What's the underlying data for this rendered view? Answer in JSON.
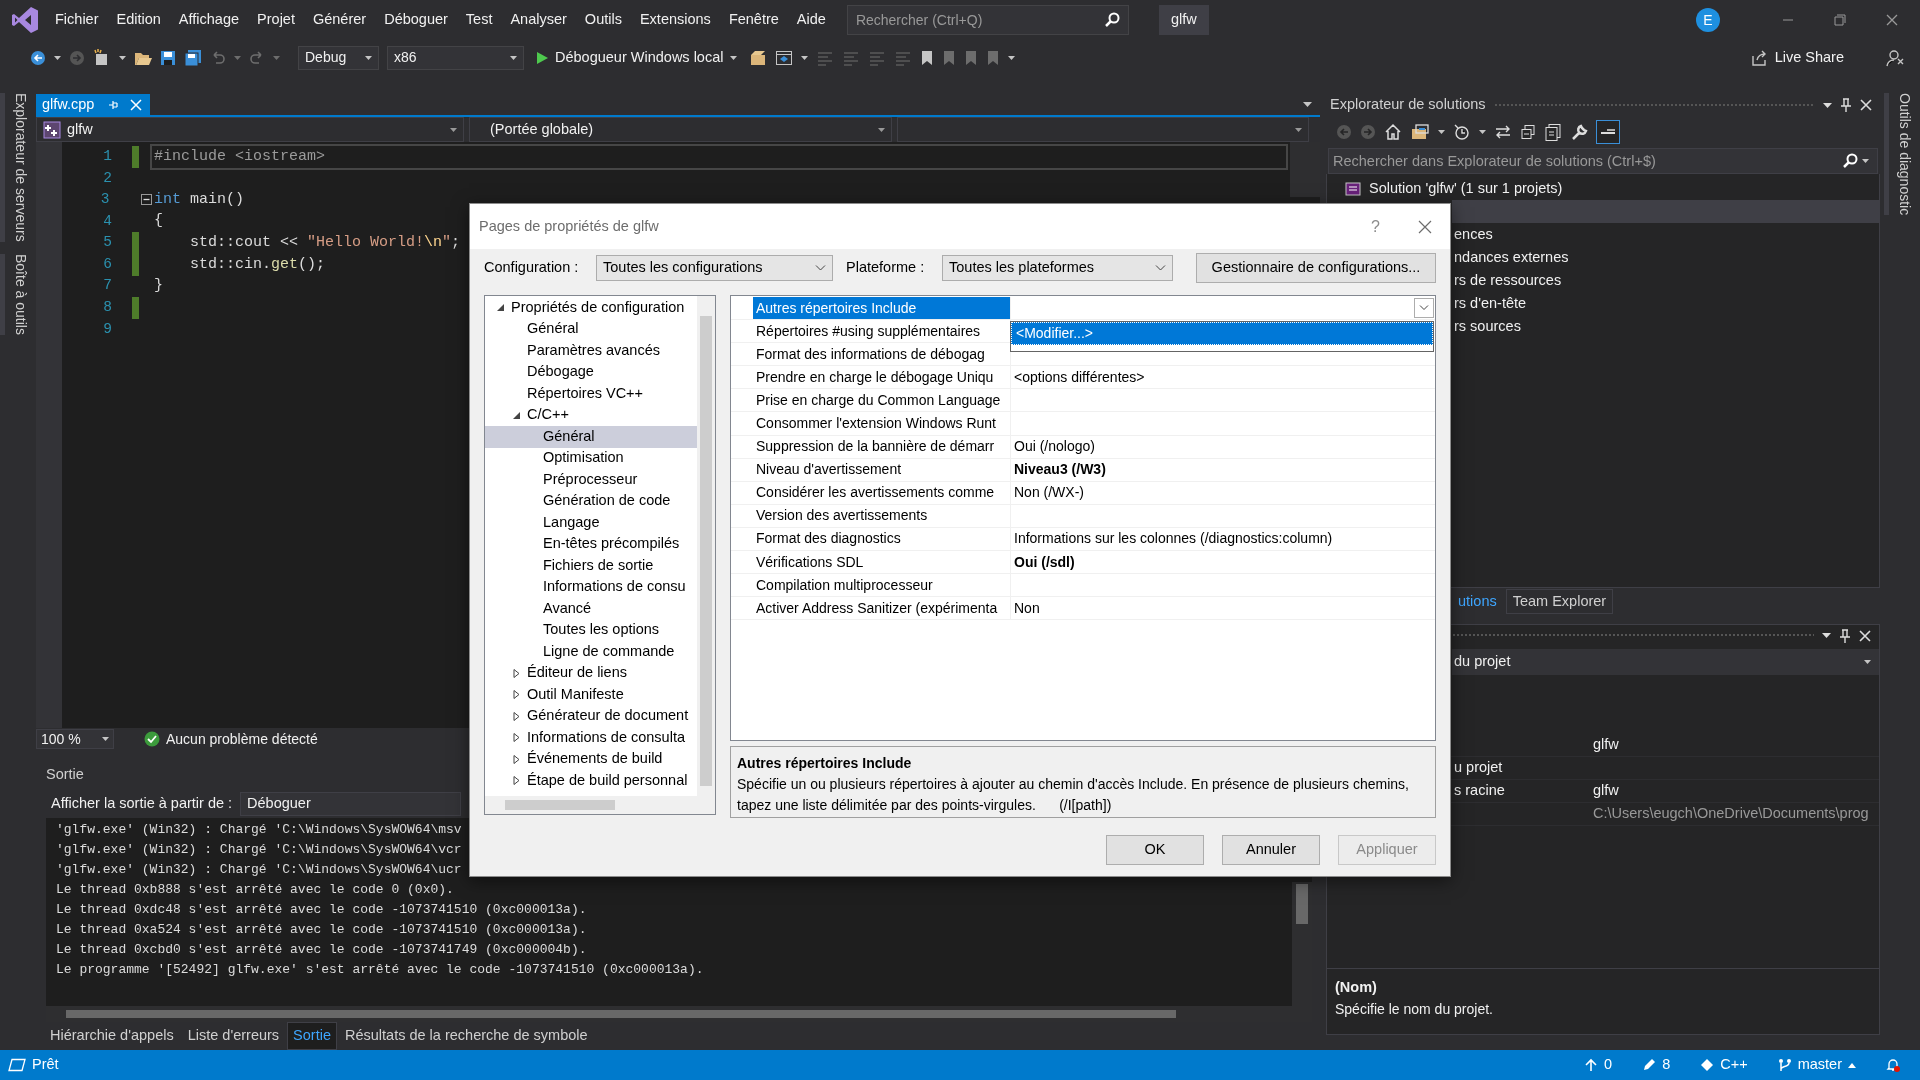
{
  "menu_bar": {
    "items": [
      "Fichier",
      "Edition",
      "Affichage",
      "Projet",
      "Générer",
      "Déboguer",
      "Test",
      "Analyser",
      "Outils",
      "Extensions",
      "Fenêtre",
      "Aide"
    ],
    "search": {
      "placeholder": "Rechercher (Ctrl+Q)"
    },
    "solution_name": "glfw",
    "avatar": "E"
  },
  "toolbar": {
    "configuration": "Debug",
    "platform": "x86",
    "run_button": "Débogueur Windows local",
    "live_share": "Live Share"
  },
  "side_tabs_left": [
    "Explorateur de serveurs",
    "Boîte à outils"
  ],
  "side_tabs_right": [
    "Outils de diagnostic"
  ],
  "editor": {
    "tabs": [
      {
        "label": "glfw.cpp",
        "selected": true
      }
    ],
    "project_combo": "glfw",
    "scope_combo": "(Portée globale)",
    "lines": [
      {
        "number": "1",
        "changed": true,
        "current": true,
        "fold_start": false,
        "code": [
          {
            "kind": "preproc",
            "text": "#include <iostream>"
          }
        ]
      },
      {
        "number": "2",
        "changed": false,
        "current": false,
        "fold_start": false
      },
      {
        "number": "3",
        "changed": false,
        "current": false,
        "fold_start": true,
        "code": [
          {
            "kind": "keyword",
            "text": "int"
          },
          {
            "kind": "plain",
            "text": " main()"
          }
        ]
      },
      {
        "number": "4",
        "changed": false,
        "current": false,
        "fold_start": false,
        "code": [
          {
            "kind": "plain",
            "text": "{"
          }
        ]
      },
      {
        "number": "5",
        "changed": true,
        "current": false,
        "fold_start": false,
        "code": [
          {
            "kind": "plain",
            "text": "    std::cout << "
          },
          {
            "kind": "string",
            "text": "\"Hello World!"
          },
          {
            "kind": "escape",
            "text": "\\n"
          },
          {
            "kind": "string",
            "text": "\""
          },
          {
            "kind": "plain",
            "text": ";"
          }
        ]
      },
      {
        "number": "6",
        "changed": true,
        "current": false,
        "fold_start": false,
        "code": [
          {
            "kind": "plain",
            "text": "    std::cin."
          },
          {
            "kind": "function",
            "text": "get"
          },
          {
            "kind": "plain",
            "text": "();"
          }
        ]
      },
      {
        "number": "7",
        "changed": false,
        "current": false,
        "fold_start": false,
        "code": [
          {
            "kind": "plain",
            "text": "}"
          }
        ]
      },
      {
        "number": "8",
        "changed": true,
        "current": false,
        "fold_start": false
      },
      {
        "number": "9",
        "changed": false,
        "current": false,
        "fold_start": false
      }
    ],
    "zoom": "100 %",
    "status": "Aucun problème détecté"
  },
  "output": {
    "title": "Sortie",
    "source_label": "Afficher la sortie à partir de :",
    "source": "Déboguer",
    "lines": [
      "'glfw.exe' (Win32) : Chargé 'C:\\Windows\\SysWOW64\\msv",
      "'glfw.exe' (Win32) : Chargé 'C:\\Windows\\SysWOW64\\vcr",
      "'glfw.exe' (Win32) : Chargé 'C:\\Windows\\SysWOW64\\ucr",
      "Le thread 0xb888 s'est arrêté avec le code 0 (0x0).",
      "Le thread 0xdc48 s'est arrêté avec le code -1073741510 (0xc000013a).",
      "Le thread 0xa524 s'est arrêté avec le code -1073741510 (0xc000013a).",
      "Le thread 0xcbd0 s'est arrêté avec le code -1073741749 (0xc000004b).",
      "Le programme '[52492] glfw.exe' s'est arrêté avec le code -1073741510 (0xc000013a)."
    ]
  },
  "bottom_tabs": [
    {
      "label": "Hiérarchie d'appels",
      "selected": false
    },
    {
      "label": "Liste d'erreurs",
      "selected": false
    },
    {
      "label": "Sortie",
      "selected": true
    },
    {
      "label": "Résultats de la recherche de symbole",
      "selected": false
    }
  ],
  "solution_explorer": {
    "title": "Explorateur de solutions",
    "search": {
      "placeholder": "Rechercher dans Explorateur de solutions (Ctrl+$)"
    },
    "items": [
      {
        "label": "Solution 'glfw' (1 sur 1 projets)",
        "selected": false
      },
      {
        "selected": true
      },
      {
        "label": "ences",
        "selected": false
      },
      {
        "label": "ndances externes",
        "selected": false
      },
      {
        "label": "rs de ressources",
        "selected": false
      },
      {
        "label": "rs d'en-tête",
        "selected": false
      },
      {
        "label": "rs sources",
        "selected": false
      }
    ],
    "tabs": [
      {
        "label": "utions",
        "selected": true
      },
      {
        "label": "Team Explorer",
        "selected": false
      }
    ]
  },
  "properties_panel": {
    "combo": "du projet",
    "rows": [
      {
        "value": {
          "text": "glfw",
          "disabled": false
        }
      },
      {
        "name": "u projet"
      },
      {
        "name": "s racine",
        "value": {
          "text": "glfw",
          "disabled": false
        }
      },
      {
        "value": {
          "text": "C:\\Users\\eugch\\OneDrive\\Documents\\prog",
          "disabled": true
        }
      }
    ],
    "description": {
      "title": "(Nom)",
      "text": "Spécifie le nom du projet."
    }
  },
  "status_bar": {
    "text": "Prêt",
    "push_count": "0",
    "pending_changes": "8",
    "language": "C++",
    "branch": "master"
  },
  "dialog": {
    "title": "Pages de propriétés de glfw",
    "help": "?",
    "configuration_label": "Configuration :",
    "configuration": "Toutes les configurations",
    "platform_label": "Plateforme :",
    "platform": "Toutes les plateformes",
    "manager_button": "Gestionnaire de configurations...",
    "tree": [
      {
        "label": "Propriétés de configuration",
        "selected": false,
        "expanded": true,
        "children": [
          {
            "label": "Général",
            "selected": false
          },
          {
            "label": "Paramètres avancés",
            "selected": false
          },
          {
            "label": "Débogage",
            "selected": false
          },
          {
            "label": "Répertoires VC++",
            "selected": false
          },
          {
            "label": "C/C++",
            "selected": false,
            "expanded": true,
            "children": [
              {
                "label": "Général",
                "selected": true
              },
              {
                "label": "Optimisation",
                "selected": false
              },
              {
                "label": "Préprocesseur",
                "selected": false
              },
              {
                "label": "Génération de code",
                "selected": false
              },
              {
                "label": "Langage",
                "selected": false
              },
              {
                "label": "En-têtes précompilés",
                "selected": false
              },
              {
                "label": "Fichiers de sortie",
                "selected": false
              },
              {
                "label": "Informations de consu",
                "selected": false
              },
              {
                "label": "Avancé",
                "selected": false
              },
              {
                "label": "Toutes les options",
                "selected": false
              },
              {
                "label": "Ligne de commande",
                "selected": false
              }
            ]
          },
          {
            "label": "Éditeur de liens",
            "selected": false,
            "expanded": false
          },
          {
            "label": "Outil Manifeste",
            "selected": false,
            "expanded": false
          },
          {
            "label": "Générateur de document",
            "selected": false,
            "expanded": false
          },
          {
            "label": "Informations de consulta",
            "selected": false,
            "expanded": false
          },
          {
            "label": "Événements de build",
            "selected": false,
            "expanded": false
          },
          {
            "label": "Étape de build personnal",
            "selected": false,
            "expanded": false
          }
        ]
      }
    ],
    "properties": [
      {
        "name": "Autres répertoires Include",
        "selected": true
      },
      {
        "name": "Répertoires #using supplémentaires",
        "selected": false
      },
      {
        "name": "Format des informations de débogag",
        "selected": false
      },
      {
        "name": "Prendre en charge le débogage Uniqu",
        "value": {
          "text": "<options différentes>",
          "modified": false
        },
        "selected": false
      },
      {
        "name": "Prise en charge du Common Language",
        "selected": false
      },
      {
        "name": "Consommer l'extension Windows Runt",
        "selected": false
      },
      {
        "name": "Suppression de la bannière de démarr",
        "value": {
          "text": "Oui (/nologo)",
          "modified": false
        },
        "selected": false
      },
      {
        "name": "Niveau d'avertissement",
        "value": {
          "text": "Niveau3 (/W3)",
          "modified": true
        },
        "selected": false
      },
      {
        "name": "Considérer les avertissements comme",
        "value": {
          "text": "Non (/WX-)",
          "modified": false
        },
        "selected": false
      },
      {
        "name": "Version des avertissements",
        "selected": false
      },
      {
        "name": "Format des diagnostics",
        "value": {
          "text": "Informations sur les colonnes (/diagnostics:column)",
          "modified": false
        },
        "selected": false
      },
      {
        "name": "Vérifications SDL",
        "value": {
          "text": "Oui (/sdl)",
          "modified": true
        },
        "selected": false
      },
      {
        "name": "Compilation multiprocesseur",
        "selected": false
      },
      {
        "name": "Activer Address Sanitizer (expérimenta",
        "value": {
          "text": "Non",
          "modified": false
        },
        "selected": false
      }
    ],
    "dropdown": {
      "option": "<Modifier...>"
    },
    "description": {
      "title": "Autres répertoires Include",
      "text": "Spécifie un ou plusieurs répertoires à ajouter au chemin d'accès Include. En présence de plusieurs chemins, tapez une liste délimitée par des points-virgules.      (/I[path])"
    },
    "buttons": [
      {
        "label": "OK",
        "disabled": false
      },
      {
        "label": "Annuler",
        "disabled": false
      },
      {
        "label": "Appliquer",
        "disabled": true
      }
    ]
  }
}
